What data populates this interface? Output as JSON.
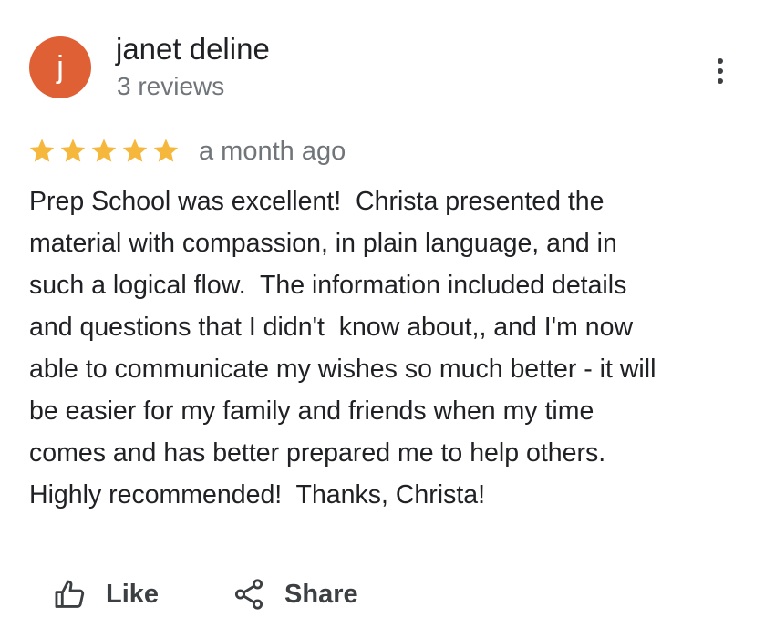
{
  "review": {
    "author": {
      "initial": "j",
      "name": "janet deline",
      "review_count": "3 reviews",
      "avatar_color": "#e06035"
    },
    "rating": {
      "stars": 5,
      "max_stars": 5,
      "star_color": "#f5b83d",
      "icon": "star-icon"
    },
    "date": "a month ago",
    "text_lines": [
      "Prep School was excellent!  Christa presented the",
      "material with compassion, in plain language, and in",
      "such a logical flow.  The information included details",
      "and questions that I didn't  know about,, and I'm now",
      "able to communicate my wishes so much better - it will",
      "be easier for my family and friends when my time",
      "comes and has better prepared me to help others.",
      "Highly recommended!  Thanks, Christa!"
    ]
  },
  "menu": {
    "icon": "more-vert-icon"
  },
  "actions": {
    "like": {
      "label": "Like",
      "icon": "thumbs-up-icon"
    },
    "share": {
      "label": "Share",
      "icon": "share-icon"
    }
  }
}
